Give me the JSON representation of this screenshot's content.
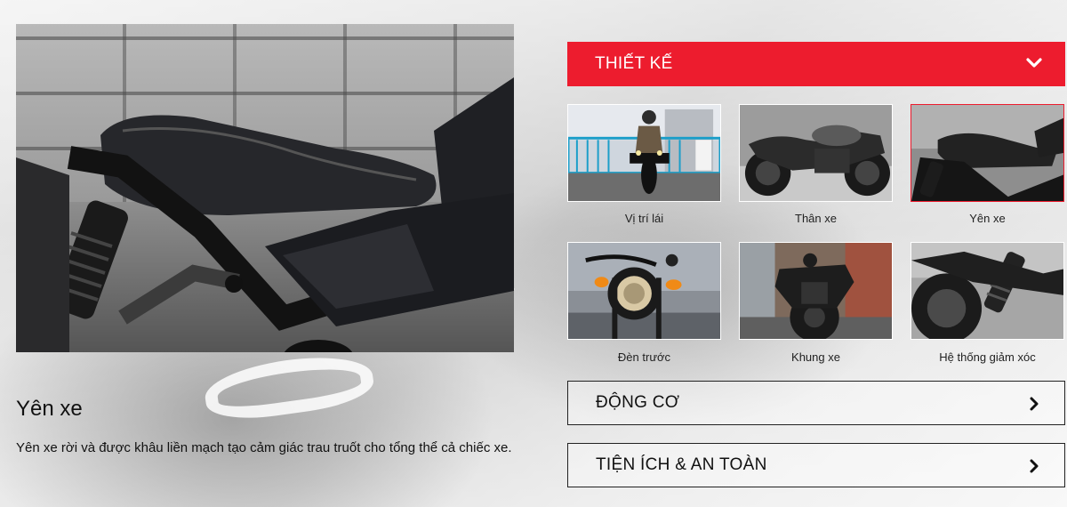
{
  "detail": {
    "title": "Yên xe",
    "description": "Yên xe rời và được khâu liền mạch tạo cảm giác trau truốt cho tổng thể cả chiếc xe.",
    "image_icon": "motorcycle-seat-photo"
  },
  "sections": {
    "design": {
      "label": "THIẾT KẾ",
      "expanded": true,
      "icon": "chevron-down-icon",
      "items": [
        {
          "label": "Vị trí lái",
          "icon": "riding-position-photo",
          "selected": false
        },
        {
          "label": "Thân xe",
          "icon": "body-photo",
          "selected": false
        },
        {
          "label": "Yên xe",
          "icon": "seat-photo",
          "selected": true
        },
        {
          "label": "Đèn trước",
          "icon": "headlight-photo",
          "selected": false
        },
        {
          "label": "Khung xe",
          "icon": "frame-photo",
          "selected": false
        },
        {
          "label": "Hệ thống giảm xóc",
          "icon": "suspension-photo",
          "selected": false
        }
      ]
    },
    "engine": {
      "label": "ĐỘNG CƠ",
      "expanded": false,
      "icon": "chevron-right-icon"
    },
    "utility": {
      "label": "TIỆN ÍCH & AN TOÀN",
      "expanded": false,
      "icon": "chevron-right-icon"
    }
  },
  "colors": {
    "accent": "#ed1c2e",
    "text": "#111111",
    "border": "#222222"
  }
}
